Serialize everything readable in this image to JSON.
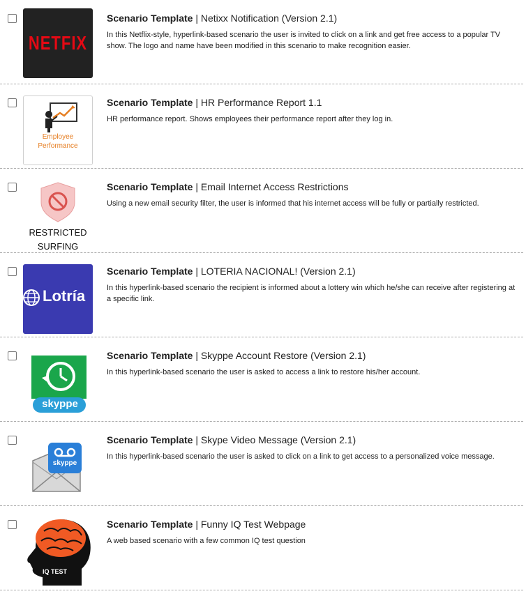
{
  "items": [
    {
      "title_prefix": "Scenario Template",
      "separator": " | ",
      "title": "Netixx Notification (Version 2.1)",
      "description": "In this Netflix-style, hyperlink-based scenario the user is invited to click on a link and get free access to a popular TV show. The logo and name have been modified in this scenario to make recognition easier.",
      "thumb_text": "NETFIX",
      "icon": "netflix-logo-icon"
    },
    {
      "title_prefix": "Scenario Template",
      "separator": " | ",
      "title": "HR Performance Report 1.1",
      "description": "HR performance report. Shows employees their performance report after they log in.",
      "thumb_text": "Employee Performance",
      "icon": "employee-performance-icon"
    },
    {
      "title_prefix": "Scenario Template",
      "separator": " | ",
      "title": "Email Internet Access Restrictions",
      "description": "Using a new email security filter, the user is informed that his internet access will be fully or partially restricted.",
      "thumb_text": "RESTRICTED SURFING",
      "icon": "restricted-shield-icon"
    },
    {
      "title_prefix": "Scenario Template",
      "separator": " | ",
      "title": "LOTERIA NACIONAL! (Version 2.1)",
      "description": "In this hyperlink-based scenario the recipient is informed about a lottery win which he/she can receive after registering at a specific link.",
      "thumb_text": "Lotría",
      "icon": "lotria-logo-icon"
    },
    {
      "title_prefix": "Scenario Template",
      "separator": " | ",
      "title": "Skyppe Account Restore (Version 2.1)",
      "description": "In this hyperlink-based scenario the user is asked to access a link to restore his/her account.",
      "thumb_text": "skyppe",
      "icon": "skyppe-restore-icon"
    },
    {
      "title_prefix": "Scenario Template",
      "separator": " | ",
      "title": "Skype Video Message (Version 2.1)",
      "description": "In this hyperlink-based scenario the user is asked to click on a link to get access to a personalized voice message.",
      "thumb_text": "skyppe",
      "icon": "skyppe-voicemail-icon"
    },
    {
      "title_prefix": "Scenario Template",
      "separator": " | ",
      "title": "Funny IQ Test Webpage",
      "description": "A web based scenario with a few common IQ test question",
      "thumb_text": "IQ TEST",
      "icon": "iq-test-brain-icon"
    }
  ],
  "colors": {
    "netflix_red": "#e50914",
    "lotria_blue": "#3a3ab0",
    "skyppe_green": "#1aa64b",
    "skyppe_blue": "#2a9fd8",
    "brain_orange": "#f05a24",
    "hr_orange": "#e67e22",
    "divider": "#aaaaaa"
  }
}
